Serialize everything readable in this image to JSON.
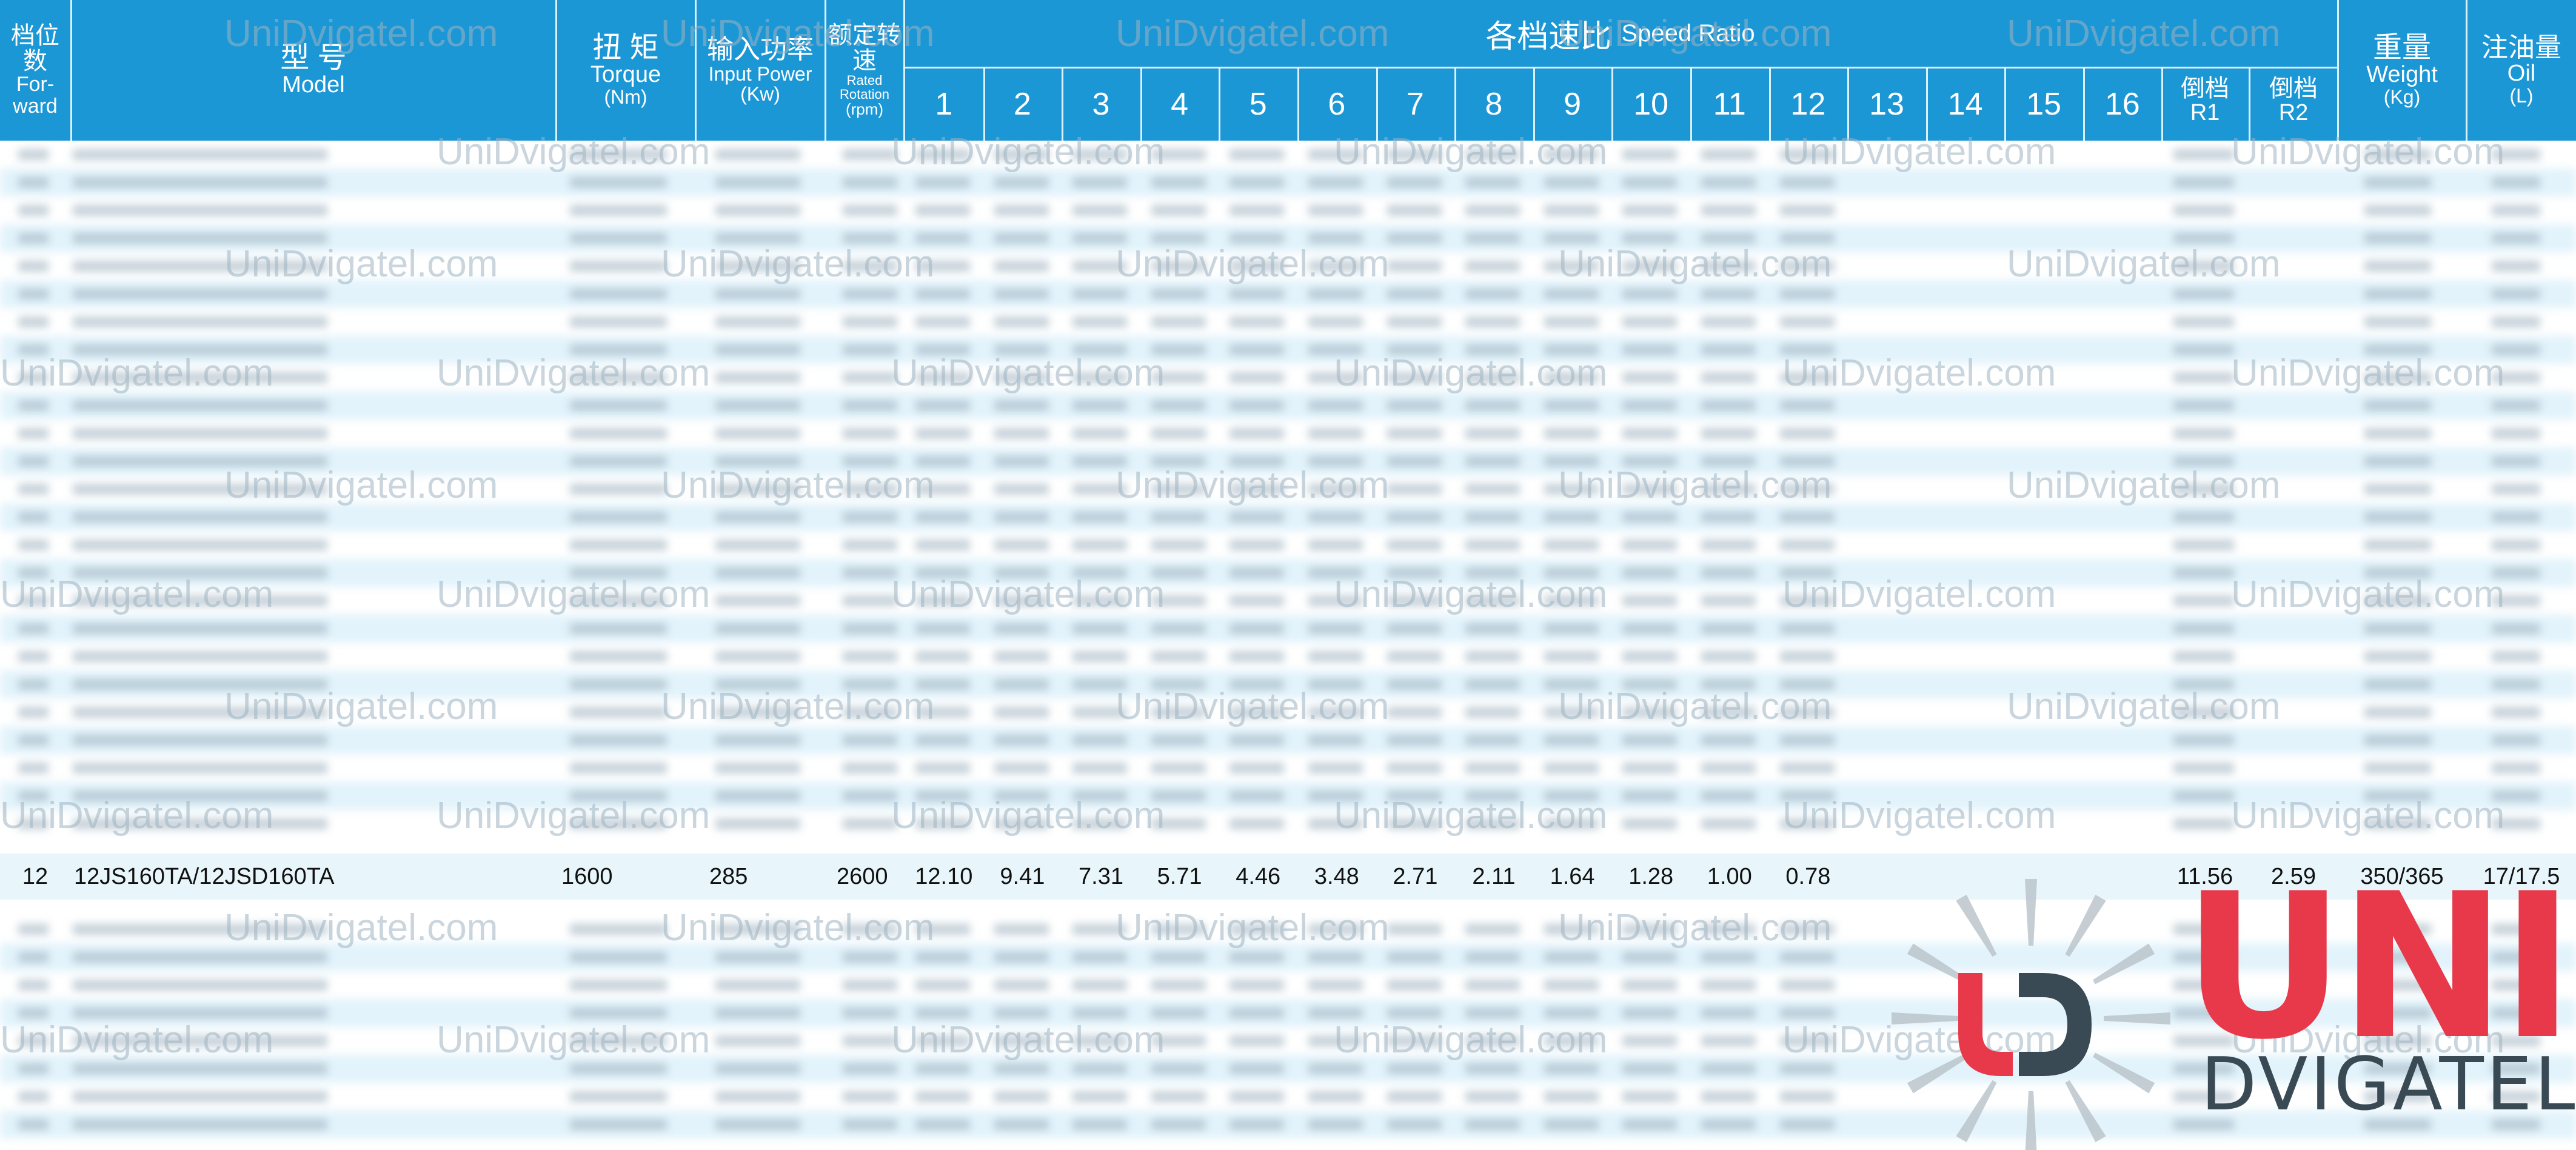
{
  "header": {
    "forward": {
      "cn": "档位数",
      "en1": "For-",
      "en2": "ward"
    },
    "model": {
      "cn": "型 号",
      "en": "Model"
    },
    "torque": {
      "cn": "扭 矩",
      "en": "Torque",
      "unit": "(Nm)"
    },
    "power": {
      "cn": "输入功率",
      "en": "Input Power",
      "unit": "(Kw)"
    },
    "rotation": {
      "cn": "额定转速",
      "en": "Rated Rotation",
      "unit": "(rpm)"
    },
    "ratio": {
      "cn": "各档速比",
      "en": "Speed Ratio"
    },
    "gears": [
      "1",
      "2",
      "3",
      "4",
      "5",
      "6",
      "7",
      "8",
      "9",
      "10",
      "11",
      "12",
      "13",
      "14",
      "15",
      "16"
    ],
    "r1": {
      "cn": "倒档",
      "en": "R1"
    },
    "r2": {
      "cn": "倒档",
      "en": "R2"
    },
    "weight": {
      "cn": "重量",
      "en": "Weight",
      "unit": "(Kg)"
    },
    "oil": {
      "cn": "注油量",
      "en": "Oil",
      "unit": "(L)"
    }
  },
  "highlighted_row": {
    "forward": "12",
    "model": "12JS160TA/12JSD160TA",
    "torque": "1600",
    "power": "285",
    "rpm": "2600",
    "ratios": [
      "12.10",
      "9.41",
      "7.31",
      "5.71",
      "4.46",
      "3.48",
      "2.71",
      "2.11",
      "1.64",
      "1.28",
      "1.00",
      "0.78",
      "",
      "",
      "",
      ""
    ],
    "r1": "11.56",
    "r2": "2.59",
    "weight": "350/365",
    "oil": "17/17.5"
  },
  "watermark": "UniDvigatel.com",
  "logo": {
    "brand": "UNI",
    "sub": "DVIGATEL",
    "mark": "UD"
  },
  "colors": {
    "header": "#1c97d6",
    "alt_row": "#e2f3fb",
    "brand_red": "#e8394b",
    "brand_dark": "#3a4a55"
  }
}
